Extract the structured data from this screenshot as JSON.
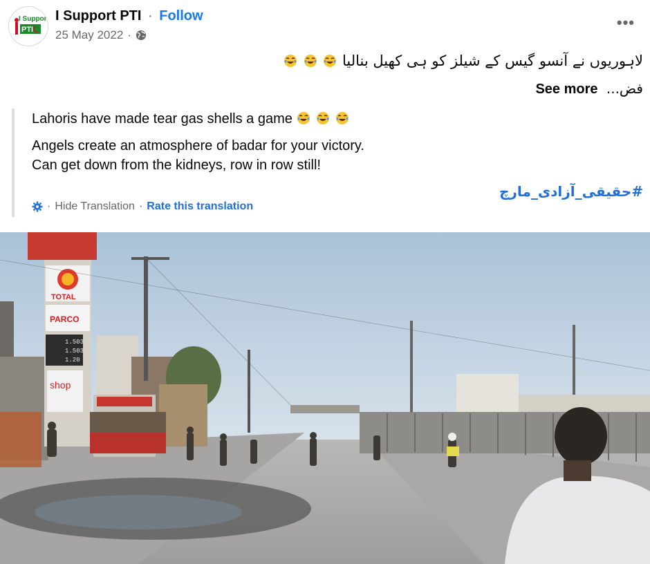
{
  "post": {
    "page_name": "I Support PTI",
    "separator": "·",
    "follow_label": "Follow",
    "date": "25 May 2022",
    "date_separator": "·",
    "privacy_icon": "globe-icon",
    "more_label": "•••",
    "urdu_text": "لاہوریوں نے آنسو گیس کے شیلز کو ہی کھیل بنالیا",
    "urdu_text_2": "فض...",
    "see_more_label": "See more",
    "emoji": "tears-of-joy",
    "emoji_count": 3
  },
  "avatar": {
    "logo_text_top": "I Support",
    "logo_text_bottom": "PTI"
  },
  "translation": {
    "line1": "Lahoris have made tear gas shells a game",
    "line2": "Angels create an atmosphere of badar for your victory.",
    "line3": "Can get down from the kidneys, row in row still!",
    "hashtag": "#حقیقی_آزادی_مارچ",
    "settings_icon": "gear-icon",
    "hide_label": "Hide Translation",
    "tools_separator": "·",
    "rate_label": "Rate this translation"
  },
  "photo": {
    "sign_top": "TOTAL",
    "sign_mid": "PARCO",
    "sign_shop": "shop",
    "prices": [
      "1.503",
      "1.503",
      "1.20"
    ]
  },
  "colors": {
    "link_blue": "#1877f2",
    "hashtag_blue": "#216fdb",
    "secondary": "#65676b",
    "quote_bar": "#dadde1"
  }
}
